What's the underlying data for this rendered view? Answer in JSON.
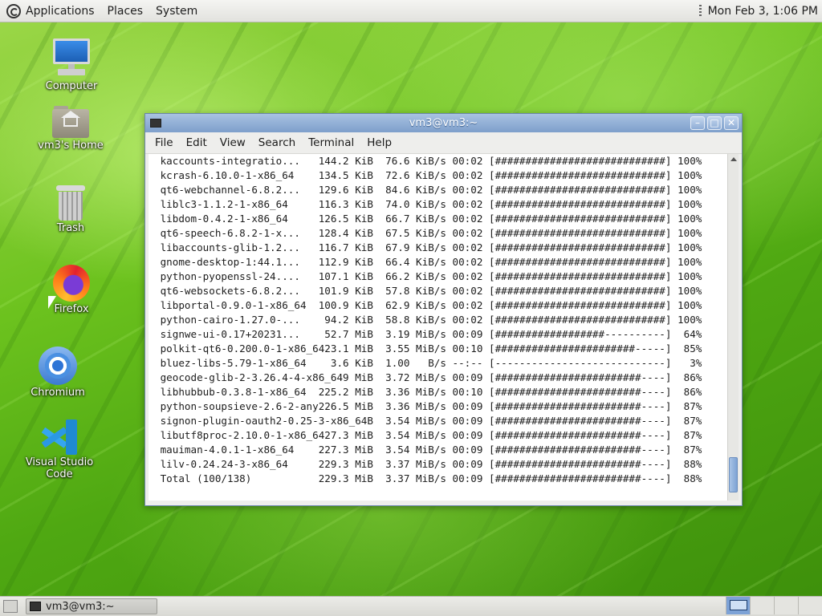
{
  "top_panel": {
    "applications": "Applications",
    "places": "Places",
    "system": "System",
    "clock": "Mon Feb  3, 1:06 PM"
  },
  "desktop_icons": {
    "computer": "Computer",
    "home": "vm3's Home",
    "trash": "Trash",
    "firefox": "Firefox",
    "chromium": "Chromium",
    "vscode": "Visual Studio Code"
  },
  "window": {
    "title": "vm3@vm3:~",
    "menu": [
      "File",
      "Edit",
      "View",
      "Search",
      "Terminal",
      "Help"
    ]
  },
  "terminal_lines": [
    " kaccounts-integratio...   144.2 KiB  76.6 KiB/s 00:02 [############################] 100%",
    " kcrash-6.10.0-1-x86_64    134.5 KiB  72.6 KiB/s 00:02 [############################] 100%",
    " qt6-webchannel-6.8.2...   129.6 KiB  84.6 KiB/s 00:02 [############################] 100%",
    " liblc3-1.1.2-1-x86_64     116.3 KiB  74.0 KiB/s 00:02 [############################] 100%",
    " libdom-0.4.2-1-x86_64     126.5 KiB  66.7 KiB/s 00:02 [############################] 100%",
    " qt6-speech-6.8.2-1-x...   128.4 KiB  67.5 KiB/s 00:02 [############################] 100%",
    " libaccounts-glib-1.2...   116.7 KiB  67.9 KiB/s 00:02 [############################] 100%",
    " gnome-desktop-1:44.1...   112.9 KiB  66.4 KiB/s 00:02 [############################] 100%",
    " python-pyopenssl-24....   107.1 KiB  66.2 KiB/s 00:02 [############################] 100%",
    " qt6-websockets-6.8.2...   101.9 KiB  57.8 KiB/s 00:02 [############################] 100%",
    " libportal-0.9.0-1-x86_64  100.9 KiB  62.9 KiB/s 00:02 [############################] 100%",
    " python-cairo-1.27.0-...    94.2 KiB  58.8 KiB/s 00:02 [############################] 100%",
    " signwe-ui-0.17+20231...    52.7 MiB  3.19 MiB/s 00:09 [##################----------]  64%",
    " polkit-qt6-0.200.0-1-x86_6423.1 MiB  3.55 MiB/s 00:10 [#######################-----]  85%",
    " bluez-libs-5.79-1-x86_64    3.6 KiB  1.00   B/s --:-- [----------------------------]   3%",
    " geocode-glib-2-3.26.4-4-x86_649 MiB  3.72 MiB/s 00:09 [########################----]  86%",
    " libhubbub-0.3.8-1-x86_64  225.2 MiB  3.36 MiB/s 00:10 [########################----]  86%",
    " python-soupsieve-2.6-2-any226.5 MiB  3.36 MiB/s 00:09 [########################----]  87%",
    " signon-plugin-oauth2-0.25-3-x86_64B  3.54 MiB/s 00:09 [########################----]  87%",
    " libutf8proc-2.10.0-1-x86_6427.3 MiB  3.54 MiB/s 00:09 [########################----]  87%",
    " mauiman-4.0.1-1-x86_64    227.3 MiB  3.54 MiB/s 00:09 [########################----]  87%",
    " lilv-0.24.24-3-x86_64     229.3 MiB  3.37 MiB/s 00:09 [########################----]  88%",
    " Total (100/138)           229.3 MiB  3.37 MiB/s 00:09 [########################----]  88%"
  ],
  "taskbar": {
    "task_label": "vm3@vm3:~"
  }
}
